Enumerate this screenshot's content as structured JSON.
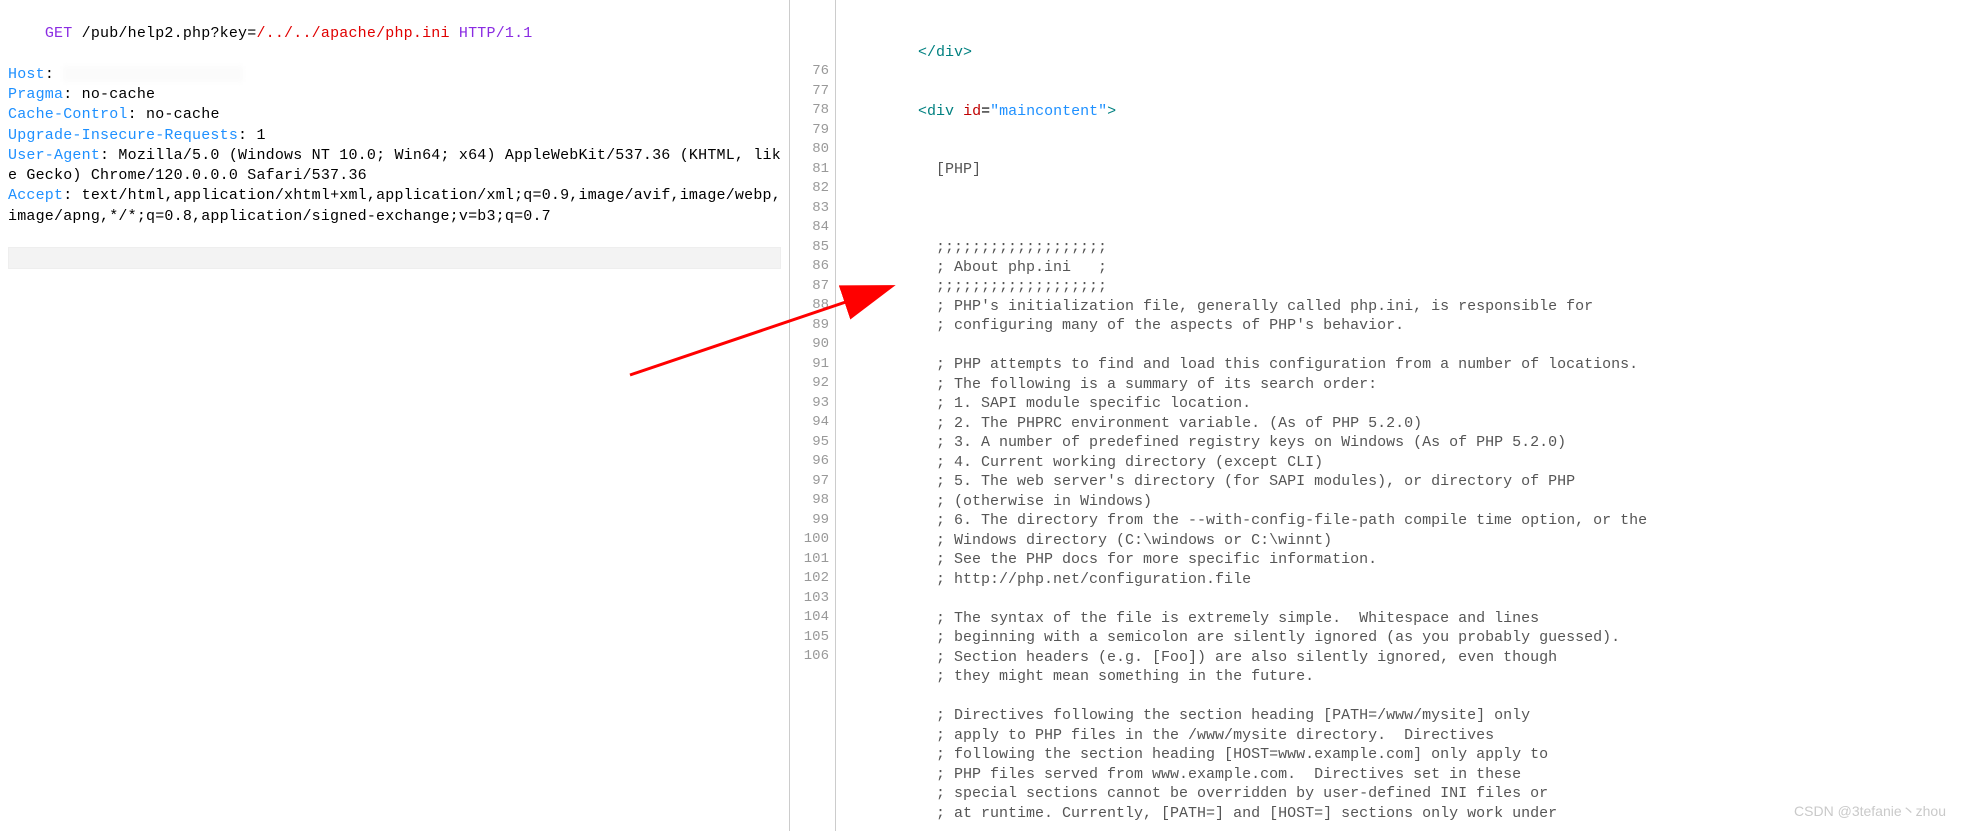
{
  "request": {
    "method_line": {
      "method": "GET",
      "path_prefix": " /pub/help2.php?key=",
      "path_highlight": "/../../apache/php.ini",
      "proto": " HTTP/1.1"
    },
    "headers": [
      {
        "name": "Host",
        "value_masked": true
      },
      {
        "name": "Pragma",
        "value": "no-cache"
      },
      {
        "name": "Cache-Control",
        "value": "no-cache"
      },
      {
        "name": "Upgrade-Insecure-Requests",
        "value": "1"
      },
      {
        "name": "User-Agent",
        "value": "Mozilla/5.0 (Windows NT 10.0; Win64; x64) AppleWebKit/537.36 (KHTML, like Gecko) Chrome/120.0.0.0 Safari/537.36"
      },
      {
        "name": "Accept",
        "value": "text/html,application/xhtml+xml,application/xml;q=0.9,image/avif,image/webp,image/apng,*/*;q=0.8,application/signed-exchange;v=b3;q=0.7"
      }
    ]
  },
  "response_html": {
    "closing_div": "</div>",
    "open_div_tag": "div",
    "open_div_attr": "id",
    "open_div_val": "maincontent",
    "section_text": "[PHP]"
  },
  "line_numbers_start": 76,
  "line_numbers_end": 106,
  "php_ini_lines": [
    "",
    ";;;;;;;;;;;;;;;;;;;",
    "; About php.ini   ;",
    ";;;;;;;;;;;;;;;;;;;",
    "; PHP's initialization file, generally called php.ini, is responsible for",
    "; configuring many of the aspects of PHP's behavior.",
    "",
    "; PHP attempts to find and load this configuration from a number of locations.",
    "; The following is a summary of its search order:",
    "; 1. SAPI module specific location.",
    "; 2. The PHPRC environment variable. (As of PHP 5.2.0)",
    "; 3. A number of predefined registry keys on Windows (As of PHP 5.2.0)",
    "; 4. Current working directory (except CLI)",
    "; 5. The web server's directory (for SAPI modules), or directory of PHP",
    "; (otherwise in Windows)",
    "; 6. The directory from the --with-config-file-path compile time option, or the",
    "; Windows directory (C:\\windows or C:\\winnt)",
    "; See the PHP docs for more specific information.",
    "; http://php.net/configuration.file",
    "",
    "; The syntax of the file is extremely simple.  Whitespace and lines",
    "; beginning with a semicolon are silently ignored (as you probably guessed).",
    "; Section headers (e.g. [Foo]) are also silently ignored, even though",
    "; they might mean something in the future.",
    "",
    "; Directives following the section heading [PATH=/www/mysite] only",
    "; apply to PHP files in the /www/mysite directory.  Directives",
    "; following the section heading [HOST=www.example.com] only apply to",
    "; PHP files served from www.example.com.  Directives set in these",
    "; special sections cannot be overridden by user-defined INI files or",
    "; at runtime. Currently, [PATH=] and [HOST=] sections only work under"
  ],
  "watermark": "CSDN @3tefanie丶zhou"
}
